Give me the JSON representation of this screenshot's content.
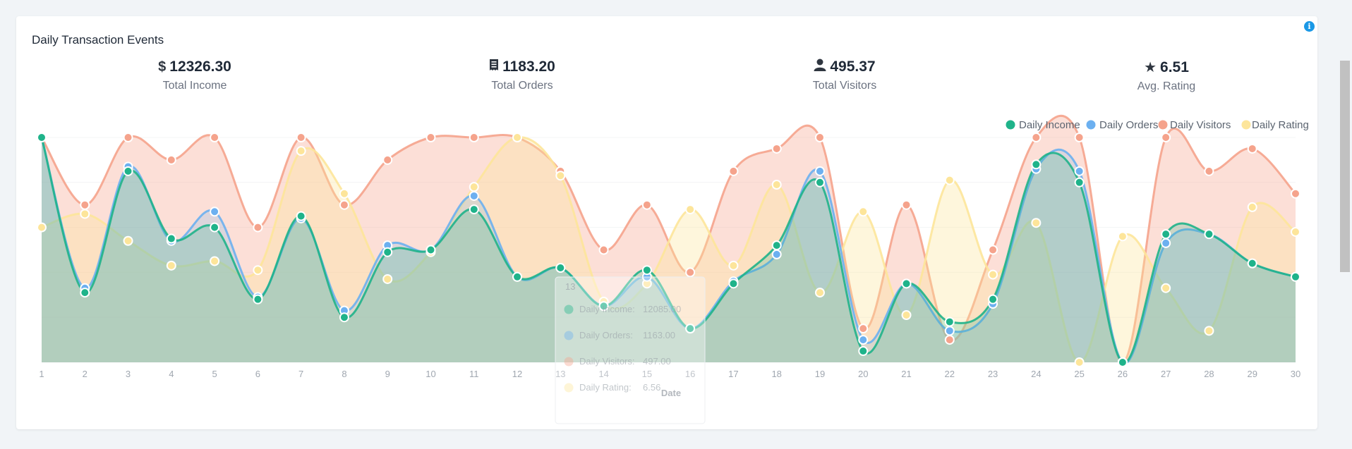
{
  "card": {
    "title": "Daily Transaction Events",
    "info_icon": "info-icon"
  },
  "stats": [
    {
      "icon": "dollar-icon",
      "glyph": "$",
      "value": "12326.30",
      "label": "Total Income"
    },
    {
      "icon": "receipt-icon",
      "glyph": "🧾",
      "value": "1183.20",
      "label": "Total Orders"
    },
    {
      "icon": "user-icon",
      "glyph": "👤",
      "value": "495.37",
      "label": "Total Visitors"
    },
    {
      "icon": "star-icon",
      "glyph": "★",
      "value": "6.51",
      "label": "Avg. Rating"
    }
  ],
  "tooltip": {
    "title": "13",
    "rows": [
      {
        "label": "Daily Income:",
        "value": "12085.00"
      },
      {
        "label": "Daily Orders:",
        "value": "1163.00"
      },
      {
        "label": "Daily Visitors:",
        "value": "497.00"
      },
      {
        "label": "Daily Rating:",
        "value": "6.56"
      }
    ]
  },
  "chart_data": {
    "type": "area",
    "title": "",
    "xlabel": "Date",
    "ylabel": "",
    "x": [
      1,
      2,
      3,
      4,
      5,
      6,
      7,
      8,
      9,
      10,
      11,
      12,
      13,
      14,
      15,
      16,
      17,
      18,
      19,
      20,
      21,
      22,
      23,
      24,
      25,
      26,
      27,
      28,
      29,
      30
    ],
    "legend_position": "top-right",
    "grid": true,
    "series": [
      {
        "name": "Daily Income",
        "color": "#1fb38a",
        "values": [
          1.0,
          0.31,
          0.85,
          0.55,
          0.6,
          0.28,
          0.65,
          0.2,
          0.49,
          0.5,
          0.68,
          0.38,
          0.42,
          0.25,
          0.41,
          0.15,
          0.35,
          0.52,
          0.8,
          0.05,
          0.35,
          0.18,
          0.28,
          0.88,
          0.8,
          0.0,
          0.57,
          0.57,
          0.44,
          0.38
        ]
      },
      {
        "name": "Daily Orders",
        "color": "#6cb0f0",
        "values": [
          1.0,
          0.33,
          0.87,
          0.54,
          0.67,
          0.29,
          0.64,
          0.23,
          0.52,
          0.5,
          0.74,
          0.38,
          0.42,
          0.25,
          0.38,
          0.15,
          0.36,
          0.48,
          0.85,
          0.1,
          0.35,
          0.14,
          0.26,
          0.86,
          0.85,
          0.0,
          0.53,
          0.57,
          0.44,
          0.38
        ]
      },
      {
        "name": "Daily Visitors",
        "color": "#f5a38c",
        "values": [
          1.0,
          0.7,
          1.0,
          0.9,
          1.0,
          0.6,
          1.0,
          0.7,
          0.9,
          1.0,
          1.0,
          1.0,
          0.85,
          0.5,
          0.7,
          0.4,
          0.85,
          0.95,
          1.0,
          0.15,
          0.7,
          0.1,
          0.5,
          1.0,
          1.0,
          0.0,
          1.0,
          0.85,
          0.95,
          0.75
        ]
      },
      {
        "name": "Daily Rating",
        "color": "#fde59a",
        "values": [
          0.6,
          0.66,
          0.54,
          0.43,
          0.45,
          0.41,
          0.94,
          0.75,
          0.37,
          0.49,
          0.78,
          1.0,
          0.83,
          0.27,
          0.35,
          0.68,
          0.43,
          0.79,
          0.31,
          0.67,
          0.21,
          0.81,
          0.39,
          0.62,
          0.0,
          0.56,
          0.33,
          0.14,
          0.69,
          0.58
        ]
      }
    ]
  }
}
